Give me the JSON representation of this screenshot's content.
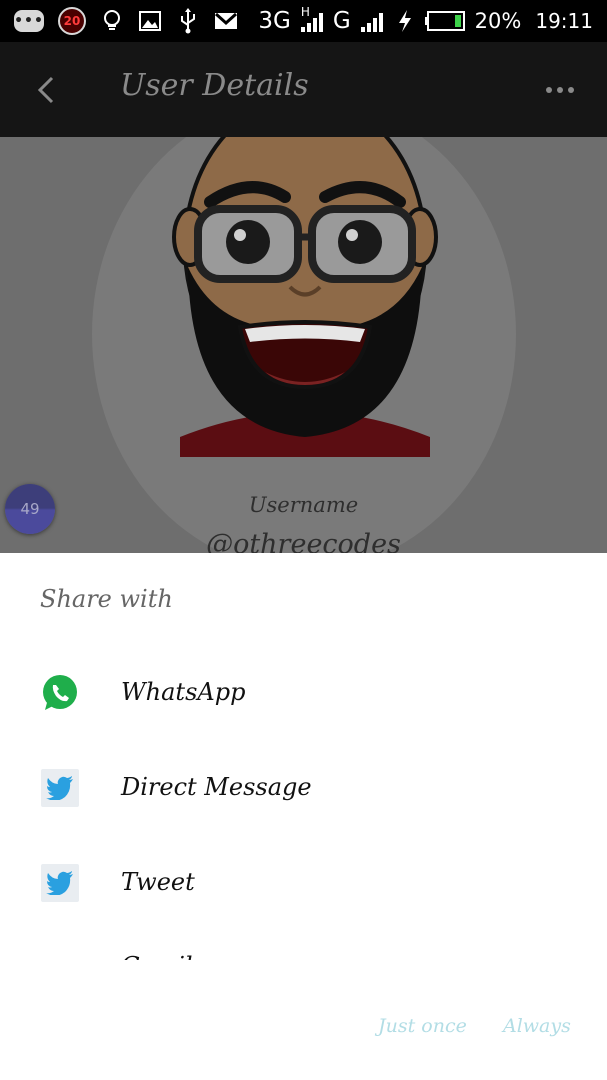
{
  "status_bar": {
    "notification_badge": "20",
    "network_3g": "3G",
    "network_h": "H",
    "network_g": "G",
    "battery_percent": "20%",
    "time": "19:11",
    "icons": [
      "chat-icon",
      "notification-badge",
      "lightbulb-icon",
      "image-icon",
      "usb-icon",
      "gmail-icon",
      "signal-icon",
      "signal-icon",
      "charging-icon",
      "battery-icon"
    ]
  },
  "app_bar": {
    "title": "User Details",
    "back_icon": "chevron-left-icon",
    "more_icon": "more-horizontal-icon"
  },
  "profile": {
    "username_label": "Username",
    "username_value": "@othreecodes",
    "fab_badge": "49"
  },
  "share_sheet": {
    "title": "Share with",
    "items": [
      {
        "label": "WhatsApp",
        "icon": "whatsapp-icon"
      },
      {
        "label": "Direct Message",
        "icon": "twitter-icon"
      },
      {
        "label": "Tweet",
        "icon": "twitter-icon"
      },
      {
        "label": "Gmail",
        "icon": "gmail-icon"
      }
    ],
    "actions": {
      "just_once": "Just once",
      "always": "Always"
    }
  },
  "colors": {
    "status_bar_bg": "#000000",
    "app_bar_bg": "#151515",
    "dim_overlay_bg": "#6e6e6e",
    "sheet_bg": "#ffffff",
    "whatsapp_green": "#1fae4b",
    "twitter_blue": "#2aa0e0",
    "action_text": "#b2dde5",
    "fab_purple": "#4b4a9c"
  }
}
